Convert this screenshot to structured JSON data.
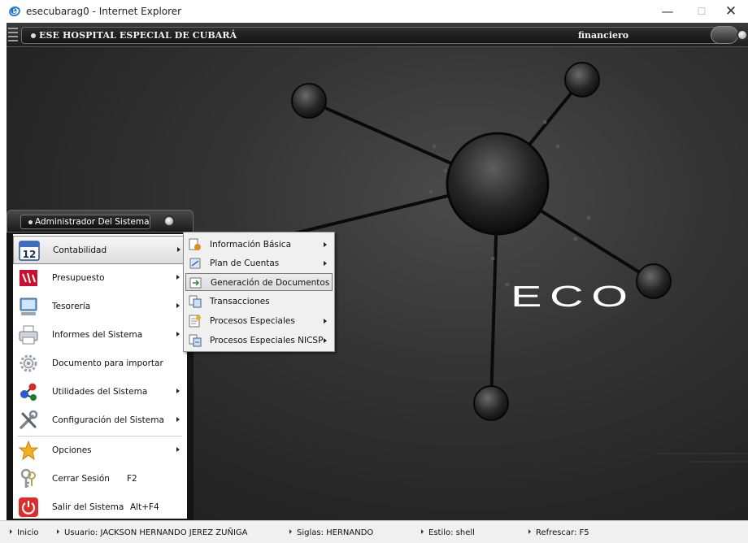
{
  "window": {
    "title": "esecubarag0 - Internet Explorer",
    "minimize_glyph": "—",
    "maximize_glyph": "☐",
    "close_glyph": "✕"
  },
  "header": {
    "title": "ESE HOSPITAL ESPECIAL DE CUBARÁ",
    "module": "financiero"
  },
  "brand": {
    "logo_text": "ECO"
  },
  "panel": {
    "title": "Administrador Del Sistema"
  },
  "menu": {
    "items": [
      {
        "label": "Contabilidad",
        "icon": "calendar-12-icon",
        "calendar_number": "12",
        "has_submenu": true,
        "active": true
      },
      {
        "label": "Presupuesto",
        "icon": "budget-icon",
        "has_submenu": true
      },
      {
        "label": "Tesorería",
        "icon": "monitor-icon",
        "has_submenu": true
      },
      {
        "label": "Informes del Sistema",
        "icon": "printer-icon",
        "has_submenu": true
      },
      {
        "label": "Documento para importar",
        "icon": "gear-icon",
        "has_submenu": false
      },
      {
        "label": "Utilidades del Sistema",
        "icon": "molecule-icon",
        "has_submenu": true
      },
      {
        "label": "Configuración del Sistema",
        "icon": "tools-icon",
        "has_submenu": true
      },
      {
        "label": "Opciones",
        "icon": "star-icon",
        "has_submenu": true
      },
      {
        "label": "Cerrar Sesión",
        "icon": "keys-icon",
        "shortcut": "F2"
      },
      {
        "label": "Salir del Sistema",
        "icon": "power-icon",
        "shortcut": "Alt+F4"
      }
    ]
  },
  "submenu": {
    "items": [
      {
        "label": "Información Básica",
        "icon": "info-doc-icon",
        "has_submenu": true
      },
      {
        "label": "Plan de Cuentas",
        "icon": "accounts-plan-icon",
        "has_submenu": true
      },
      {
        "label": "Generación de Documentos",
        "icon": "generate-docs-icon",
        "has_submenu": false,
        "active": true
      },
      {
        "label": "Transacciones",
        "icon": "transactions-icon",
        "has_submenu": false
      },
      {
        "label": "Procesos Especiales",
        "icon": "special-process-icon",
        "has_submenu": true
      },
      {
        "label": "Procesos Especiales NICSP",
        "icon": "nicsp-process-icon",
        "has_submenu": true
      }
    ]
  },
  "status": {
    "inicio": "Inicio",
    "usuario": "Usuario:  JACKSON HERNANDO JEREZ ZUÑIGA",
    "siglas": "Siglas:  HERNANDO",
    "estilo": "Estilo:  shell",
    "refrescar": "Refrescar: F5"
  },
  "colors": {
    "desktop_bg": "#2b2b2b",
    "menu_bg": "#ffffff",
    "submenu_bg": "#f0f0f0",
    "statusbar_bg": "#f0f0f0",
    "ie_blue": "#2a7fd4"
  }
}
